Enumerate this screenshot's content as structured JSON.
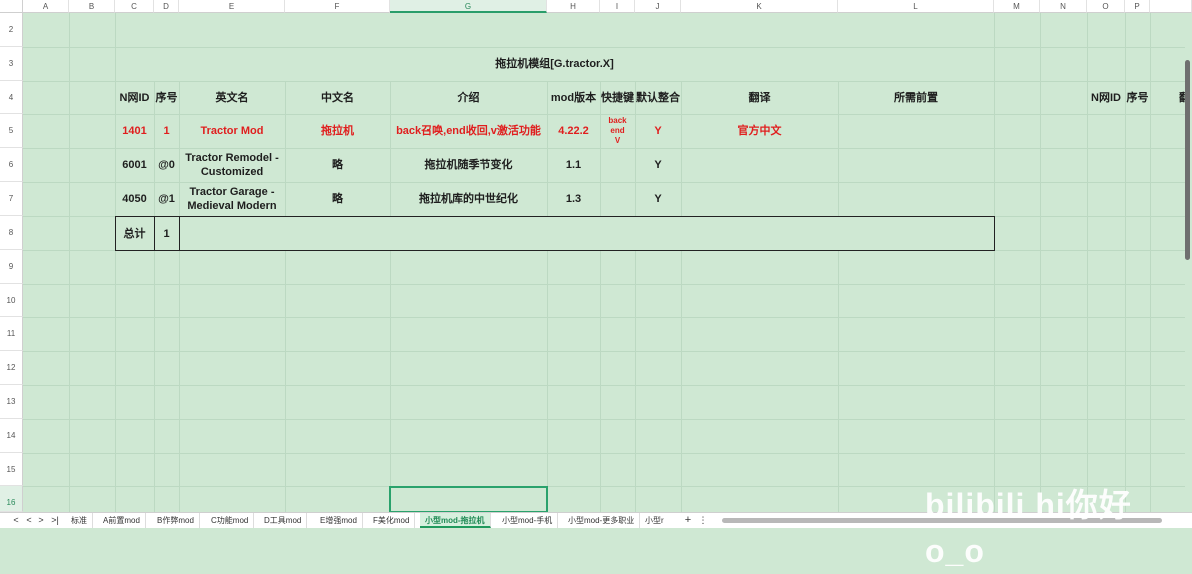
{
  "sheet": {
    "columns": [
      "A",
      "B",
      "C",
      "D",
      "E",
      "F",
      "G",
      "H",
      "I",
      "J",
      "K",
      "L",
      "M",
      "N",
      "O",
      "P"
    ],
    "rows": [
      "2",
      "3",
      "4",
      "5",
      "6",
      "7",
      "8",
      "9",
      "10",
      "11",
      "12",
      "13",
      "14",
      "15",
      "16"
    ],
    "selected_column": "G",
    "selected_row": "16",
    "title": "拖拉机模组[G.tractor.X]",
    "headers": {
      "nid": "N网ID",
      "seq": "序号",
      "en": "英文名",
      "cn": "中文名",
      "desc": "介绍",
      "ver": "mod版本",
      "hotkey": "快捷键",
      "default": "默认整合",
      "trans": "翻译",
      "prereq": "所需前置",
      "nid2": "N网ID",
      "seq2": "序号",
      "extra": "翻"
    },
    "rows_data": [
      {
        "nid": "1401",
        "seq": "1",
        "en": "Tractor Mod",
        "cn": "拖拉机",
        "desc": "back召唤,end收回,v激活功能",
        "ver": "4.22.2",
        "hotkey": "back\nend\nV",
        "default": "Y",
        "trans": "官方中文",
        "prereq": ""
      },
      {
        "nid": "6001",
        "seq": "@0",
        "en": "Tractor Remodel -\nCustomized",
        "cn": "略",
        "desc": "拖拉机随季节变化",
        "ver": "1.1",
        "hotkey": "",
        "default": "Y",
        "trans": "",
        "prereq": ""
      },
      {
        "nid": "4050",
        "seq": "@1",
        "en": "Tractor Garage -\nMedieval Modern",
        "cn": "略",
        "desc": "拖拉机库的中世纪化",
        "ver": "1.3",
        "hotkey": "",
        "default": "Y",
        "trans": "",
        "prereq": ""
      }
    ],
    "total_label": "总计",
    "total_value": "1",
    "accent_color": "#e01e1e"
  },
  "tabs": {
    "nav": [
      "<",
      ">",
      ">|"
    ],
    "items": [
      "标准",
      "A前置mod",
      "B作弊mod",
      "C功能mod",
      "D工具mod",
      "E增强mod",
      "F美化mod",
      "小型mod-拖拉机",
      "小型mod-手机",
      "小型mod-更多职业",
      "小型r"
    ],
    "active": "小型mod-拖拉机",
    "add": "+",
    "more": "⋮"
  },
  "watermark": "bilibili hi你好o_o"
}
